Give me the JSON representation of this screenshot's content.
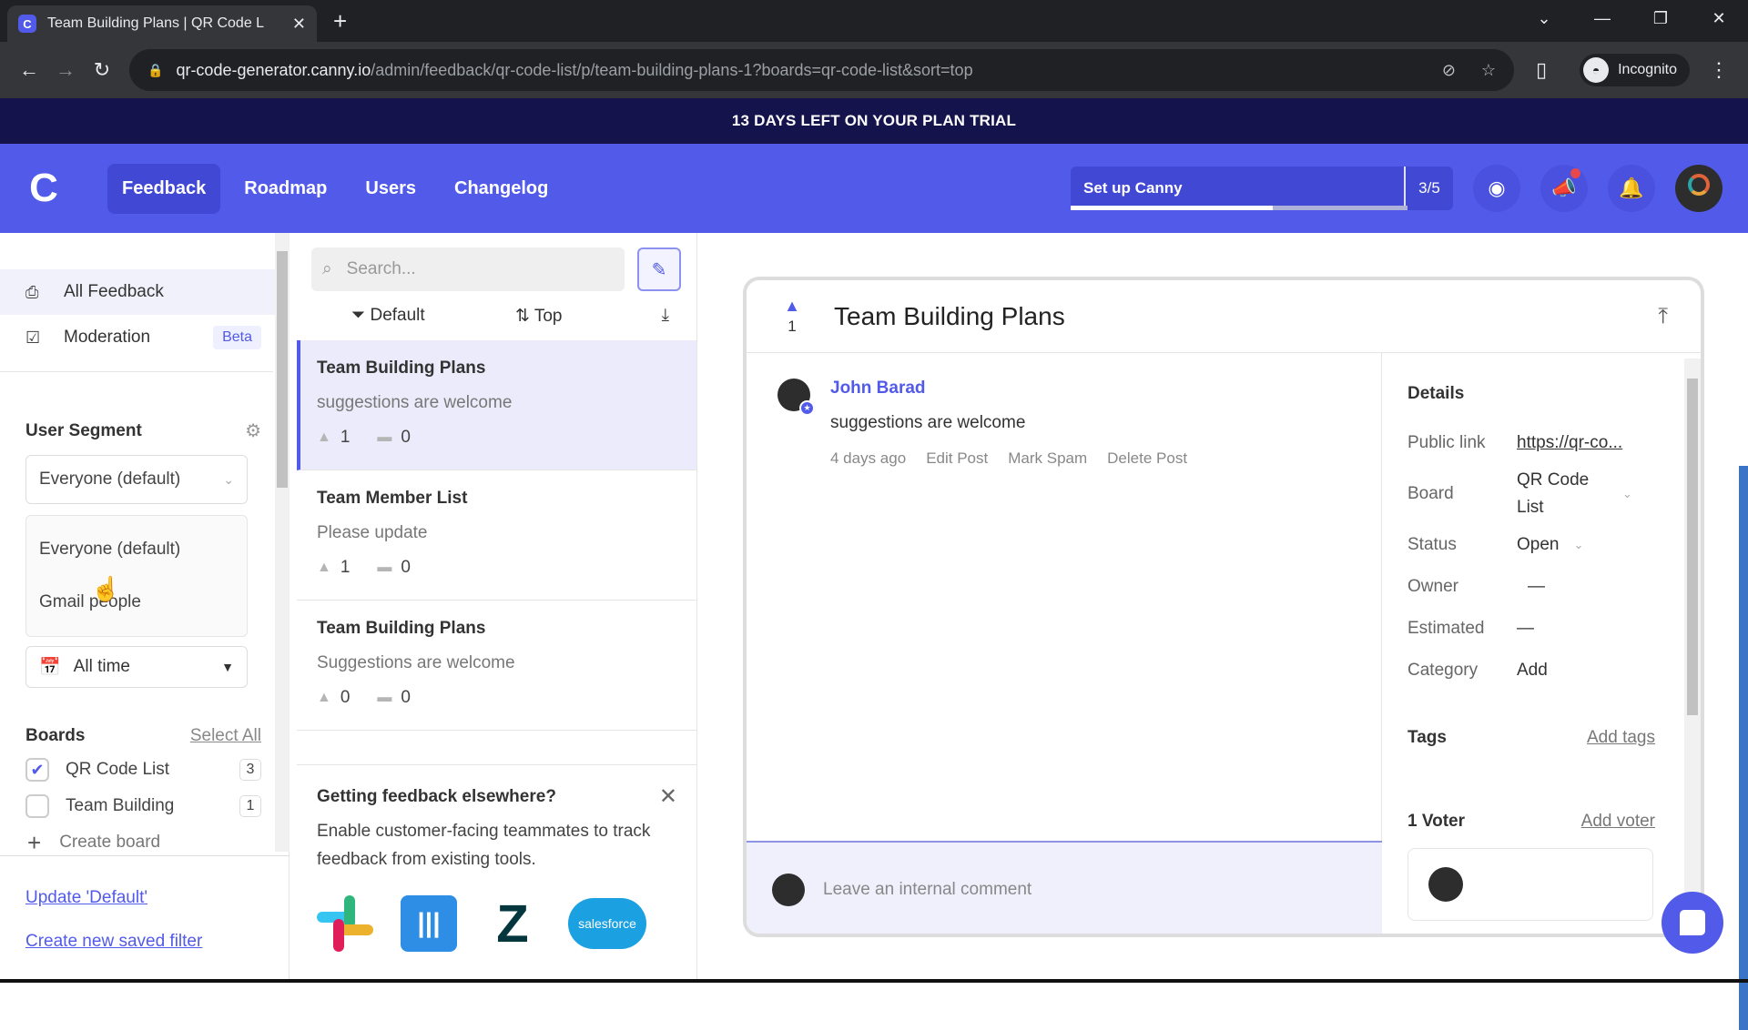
{
  "browser": {
    "tab_title": "Team Building Plans | QR Code L",
    "url_host": "qr-code-generator.canny.io",
    "url_path": "/admin/feedback/qr-code-list/p/team-building-plans-1?boards=qr-code-list&sort=top",
    "profile_label": "Incognito"
  },
  "trial_banner": "13 DAYS LEFT ON YOUR PLAN TRIAL",
  "header": {
    "nav": [
      "Feedback",
      "Roadmap",
      "Users",
      "Changelog"
    ],
    "active_nav": "Feedback",
    "setup_label": "Set up Canny",
    "setup_count": "3/5",
    "setup_progress": 0.6,
    "accent": "#525ae9"
  },
  "sidebar": {
    "items": [
      {
        "label": "All Feedback",
        "icon": "inbox-icon"
      },
      {
        "label": "Moderation",
        "icon": "clipboard-check-icon",
        "badge": "Beta"
      }
    ],
    "user_segment": {
      "title": "User Segment",
      "selected": "Everyone (default)",
      "options": [
        "Everyone (default)",
        "Gmail people"
      ]
    },
    "time_filter": "All time",
    "boards": {
      "title": "Boards",
      "select_all": "Select All",
      "items": [
        {
          "name": "QR Code List",
          "count": "3",
          "checked": true
        },
        {
          "name": "Team Building",
          "count": "1",
          "checked": false
        }
      ],
      "create_label": "Create board"
    },
    "links": [
      "Update 'Default'",
      "Create new saved filter"
    ]
  },
  "post_list": {
    "search_placeholder": "Search...",
    "filter_label": "Default",
    "sort_label": "Top",
    "posts": [
      {
        "title": "Team Building Plans",
        "desc": "suggestions are welcome",
        "votes": "1",
        "comments": "0",
        "active": true
      },
      {
        "title": "Team Member List",
        "desc": "Please update",
        "votes": "1",
        "comments": "0"
      },
      {
        "title": "Team Building Plans",
        "desc": "Suggestions are welcome",
        "votes": "0",
        "comments": "0"
      }
    ],
    "promo": {
      "title": "Getting feedback elsewhere?",
      "text": "Enable customer-facing teammates to track feedback from existing tools.",
      "integrations": [
        "Slack",
        "Intercom",
        "Zendesk",
        "salesforce"
      ]
    }
  },
  "post_detail": {
    "title": "Team Building Plans",
    "votes": "1",
    "author": "John Barad",
    "body": "suggestions are welcome",
    "time": "4 days ago",
    "actions": [
      "Edit Post",
      "Mark Spam",
      "Delete Post"
    ],
    "comment_placeholder": "Leave an internal comment",
    "details": {
      "title": "Details",
      "public_link_label": "Public link",
      "public_link": "https://qr-co...",
      "board_label": "Board",
      "board": "QR Code List",
      "status_label": "Status",
      "status": "Open",
      "owner_label": "Owner",
      "owner": "—",
      "estimated_label": "Estimated",
      "estimated": "—",
      "category_label": "Category",
      "category": "Add"
    },
    "tags_label": "Tags",
    "add_tags": "Add tags",
    "voters_label": "1 Voter",
    "add_voter": "Add voter"
  }
}
